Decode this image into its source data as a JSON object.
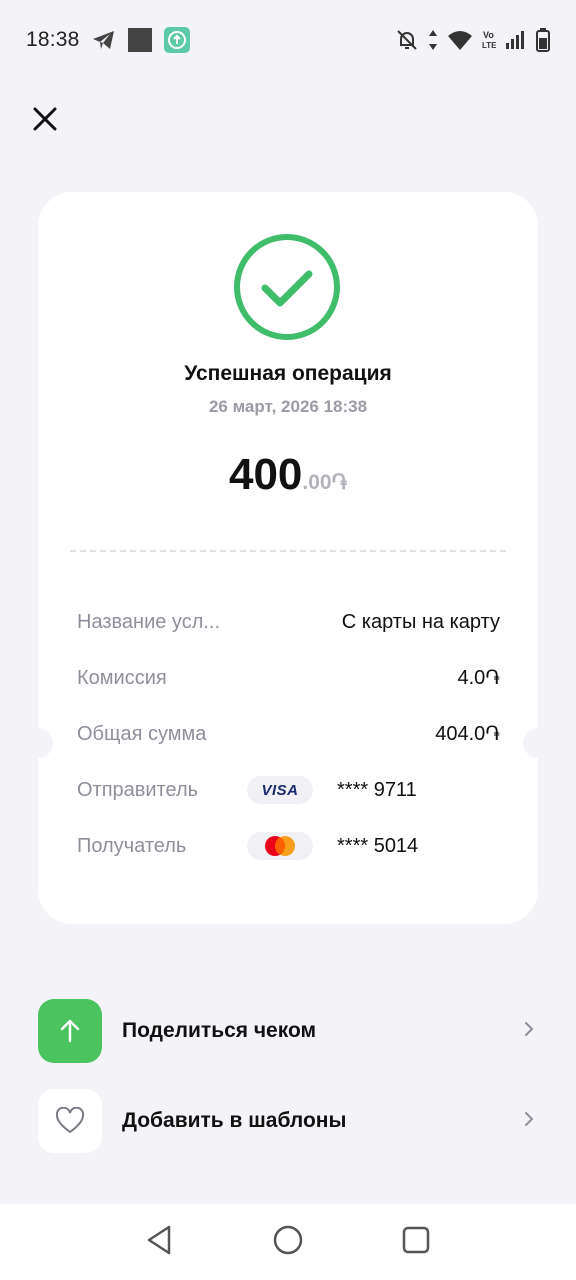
{
  "status_bar": {
    "time": "18:38",
    "icons_left": [
      "telegram-icon",
      "square-app-icon",
      "upload-app-icon"
    ],
    "icons_right": [
      "bell-off-icon",
      "data-arrows-icon",
      "wifi-icon",
      "volte-icon",
      "signal-icon",
      "battery-icon"
    ],
    "volte_text": "Vo\nLTE"
  },
  "header": {
    "close_icon": "close-icon"
  },
  "receipt": {
    "status_icon": "check-circle-icon",
    "title": "Успешная операция",
    "date": "26 март, 2026 18:38",
    "amount_main": "400",
    "amount_decimal": ".00",
    "currency_symbol": "֏",
    "details": {
      "service_label": "Название усл...",
      "service_value": "С карты на карту",
      "commission_label": "Комиссия",
      "commission_value": "4.0֏",
      "total_label": "Общая сумма",
      "total_value": "404.0֏",
      "sender_label": "Отправитель",
      "sender_card_brand": "VISA",
      "sender_card_mask": "**** 9711",
      "recipient_label": "Получатель",
      "recipient_card_brand": "mastercard",
      "recipient_card_mask": "**** 5014"
    }
  },
  "actions": [
    {
      "label": "Поделиться чеком",
      "icon": "arrow-up-icon"
    },
    {
      "label": "Добавить в шаблоны",
      "icon": "heart-icon"
    }
  ],
  "colors": {
    "accent_green": "#4bc460",
    "check_green": "#3fbd6a",
    "background": "#f4f4f8"
  },
  "nav_bar": {
    "buttons": [
      "back-icon",
      "home-icon",
      "recents-icon"
    ]
  }
}
